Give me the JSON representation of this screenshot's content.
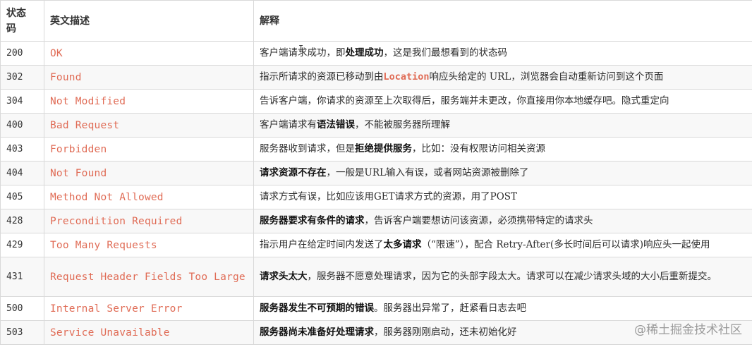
{
  "headers": {
    "code": "状态码",
    "english": "英文描述",
    "explain": "解释"
  },
  "rows": [
    {
      "code": "200",
      "english": "OK",
      "parts": [
        {
          "t": "客户端请求成功，即"
        },
        {
          "t": "处理成功",
          "b": true
        },
        {
          "t": "，这是我们最想看到的状态码"
        }
      ]
    },
    {
      "code": "302",
      "english": "Found",
      "parts": [
        {
          "t": "指示所请求的资源已移动到由"
        },
        {
          "t": "Location",
          "c": true
        },
        {
          "t": "响应头给定的 URL，浏览器会自动重新访问到这个页面"
        }
      ]
    },
    {
      "code": "304",
      "english": "Not Modified",
      "parts": [
        {
          "t": "告诉客户端，你请求的资源至上次取得后，服务端并未更改，你直接用你本地缓存吧。隐式重定向"
        }
      ]
    },
    {
      "code": "400",
      "english": "Bad Request",
      "parts": [
        {
          "t": "客户端请求有"
        },
        {
          "t": "语法错误",
          "b": true
        },
        {
          "t": "，不能被服务器所理解"
        }
      ]
    },
    {
      "code": "403",
      "english": "Forbidden",
      "parts": [
        {
          "t": "服务器收到请求，但是"
        },
        {
          "t": "拒绝提供服务",
          "b": true
        },
        {
          "t": "，比如：没有权限访问相关资源"
        }
      ]
    },
    {
      "code": "404",
      "english": "Not Found",
      "parts": [
        {
          "t": "请求资源不存在",
          "b": true
        },
        {
          "t": "，一般是URL输入有误，或者网站资源被删除了"
        }
      ]
    },
    {
      "code": "405",
      "english": "Method Not Allowed",
      "parts": [
        {
          "t": "请求方式有误，比如应该用GET请求方式的资源，用了POST"
        }
      ]
    },
    {
      "code": "428",
      "english": "Precondition Required",
      "parts": [
        {
          "t": "服务器要求有条件的请求",
          "b": true
        },
        {
          "t": "，告诉客户端要想访问该资源，必须携带特定的请求头"
        }
      ]
    },
    {
      "code": "429",
      "english": "Too Many Requests",
      "parts": [
        {
          "t": "指示用户在给定时间内发送了"
        },
        {
          "t": "太多请求",
          "b": true
        },
        {
          "t": "（“限速”），配合 Retry-After(多长时间后可以请求)响应头一起使用"
        }
      ]
    },
    {
      "code": "431",
      "english": "Request Header Fields Too Large",
      "tall": true,
      "parts": [
        {
          "t": "请求头太大",
          "b": true
        },
        {
          "t": "，服务器不愿意处理请求，因为它的头部字段太大。请求可以在减少请求头域的大小后重新提交。"
        }
      ]
    },
    {
      "code": "500",
      "english": "Internal Server Error",
      "parts": [
        {
          "t": "服务器发生不可预期的错误",
          "b": true
        },
        {
          "t": "。服务器出异常了，赶紧看日志去吧"
        }
      ]
    },
    {
      "code": "503",
      "english": "Service Unavailable",
      "parts": [
        {
          "t": "服务器尚未准备好处理请求",
          "b": true
        },
        {
          "t": "，服务器刚刚启动，还未初始化好"
        }
      ]
    }
  ],
  "watermark": "@稀土掘金技术社区"
}
